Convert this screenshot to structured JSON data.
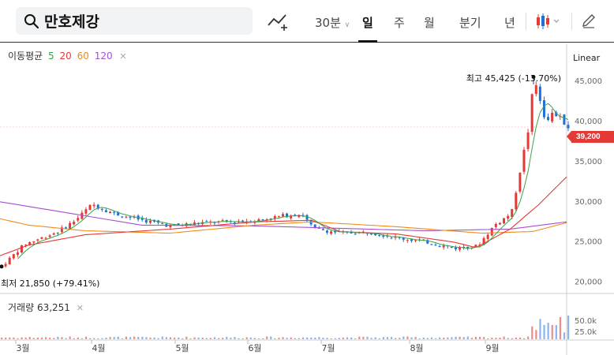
{
  "toolbar": {
    "stock_name": "만호제강",
    "periods": [
      {
        "label": "30분",
        "x": 399
      },
      {
        "label": "일",
        "x": 459
      },
      {
        "label": "주",
        "x": 499
      },
      {
        "label": "월",
        "x": 537
      },
      {
        "label": "분기",
        "x": 582
      },
      {
        "label": "년",
        "x": 639
      }
    ],
    "active_period": "일"
  },
  "legend": {
    "ma_title": "이동평균",
    "ma_periods": [
      "5",
      "20",
      "60",
      "120"
    ],
    "ma_colors": [
      "#3aa34a",
      "#e53935",
      "#f08c1a",
      "#a64fd1"
    ],
    "volume_title": "거래량",
    "volume_value": "63,251"
  },
  "scale_mode": "Linear",
  "current_price": "39,200",
  "annotations": {
    "high": "최고 45,425 (-13.70%)",
    "low": "최저 21,850 (+79.41%)"
  },
  "chart_data": {
    "type": "candlestick",
    "x_labels": [
      "3월",
      "4월",
      "5월",
      "6월",
      "7월",
      "8월",
      "9월"
    ],
    "y_ticks": [
      20000,
      25000,
      30000,
      35000,
      40000,
      45000
    ],
    "y_tick_labels": [
      "20,000",
      "25,000",
      "30,000",
      "35,000",
      "40,000",
      "45,000"
    ],
    "ylim": [
      18500,
      49500
    ],
    "volume_ticks": [
      "50.0k",
      "25.0k"
    ],
    "high": 45425,
    "low": 21850,
    "last": 39200,
    "volume_last": 63251,
    "ma120_points": [
      [
        0,
        29900
      ],
      [
        0.25,
        27000
      ],
      [
        0.45,
        26900
      ],
      [
        0.6,
        26600
      ],
      [
        0.75,
        26300
      ],
      [
        0.9,
        26500
      ],
      [
        1,
        27400
      ]
    ],
    "ma60_points": [
      [
        0,
        27800
      ],
      [
        0.05,
        27000
      ],
      [
        0.15,
        26300
      ],
      [
        0.3,
        26000
      ],
      [
        0.45,
        27000
      ],
      [
        0.55,
        27400
      ],
      [
        0.7,
        26800
      ],
      [
        0.85,
        26000
      ],
      [
        0.94,
        26200
      ],
      [
        1,
        27300
      ]
    ],
    "ma20_points": [
      [
        0,
        23200
      ],
      [
        0.05,
        24500
      ],
      [
        0.15,
        25800
      ],
      [
        0.3,
        26500
      ],
      [
        0.45,
        27400
      ],
      [
        0.55,
        27600
      ],
      [
        0.6,
        26200
      ],
      [
        0.7,
        25900
      ],
      [
        0.8,
        24900
      ],
      [
        0.84,
        24200
      ],
      [
        0.9,
        26500
      ],
      [
        0.95,
        29500
      ],
      [
        1,
        33000
      ]
    ],
    "price_path": [
      [
        0,
        21850
      ],
      [
        0.04,
        24600
      ],
      [
        0.1,
        26200
      ],
      [
        0.13,
        27600
      ],
      [
        0.16,
        29600
      ],
      [
        0.2,
        28400
      ],
      [
        0.25,
        27600
      ],
      [
        0.3,
        26900
      ],
      [
        0.35,
        27300
      ],
      [
        0.4,
        27400
      ],
      [
        0.45,
        27600
      ],
      [
        0.5,
        28200
      ],
      [
        0.53,
        28400
      ],
      [
        0.55,
        26600
      ],
      [
        0.6,
        26000
      ],
      [
        0.65,
        26100
      ],
      [
        0.7,
        25400
      ],
      [
        0.75,
        24900
      ],
      [
        0.8,
        24100
      ],
      [
        0.84,
        24400
      ],
      [
        0.87,
        27000
      ],
      [
        0.9,
        28500
      ],
      [
        0.93,
        39000
      ],
      [
        0.94,
        45400
      ],
      [
        0.96,
        40000
      ],
      [
        0.975,
        41000
      ],
      [
        1,
        39200
      ]
    ]
  }
}
